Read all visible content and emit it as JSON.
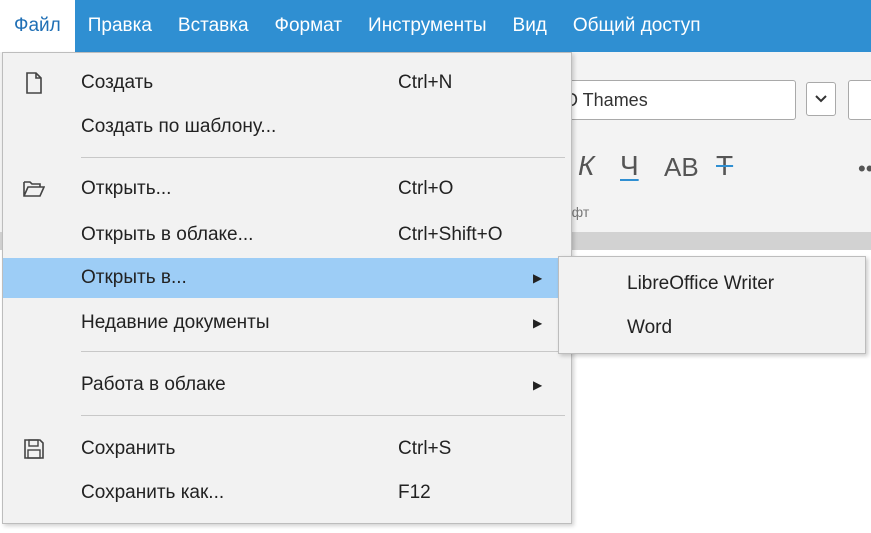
{
  "menubar": {
    "items": [
      {
        "label": "Файл"
      },
      {
        "label": "Правка"
      },
      {
        "label": "Вставка"
      },
      {
        "label": "Формат"
      },
      {
        "label": "Инструменты"
      },
      {
        "label": "Вид"
      },
      {
        "label": "Общий доступ"
      }
    ]
  },
  "toolbar": {
    "font_value": "D Thames",
    "italic_label": "К",
    "underline_label": "Ч",
    "caps_label": "АВ",
    "strike_label": "Т",
    "more_label": "••",
    "group_label": "рифт"
  },
  "file_menu": {
    "new": {
      "label": "Создать",
      "shortcut": "Ctrl+N",
      "icon": "new-document-icon"
    },
    "new_from_template": {
      "label": "Создать по шаблону..."
    },
    "open": {
      "label": "Открыть...",
      "shortcut": "Ctrl+O",
      "icon": "folder-open-icon"
    },
    "open_cloud": {
      "label": "Открыть в облаке...",
      "shortcut": "Ctrl+Shift+O"
    },
    "open_in": {
      "label": "Открыть в...",
      "has_submenu": true,
      "highlighted": true
    },
    "recent": {
      "label": "Недавние документы",
      "has_submenu": true
    },
    "cloud_work": {
      "label": "Работа в облаке",
      "has_submenu": true
    },
    "save": {
      "label": "Сохранить",
      "shortcut": "Ctrl+S",
      "icon": "save-icon"
    },
    "save_as": {
      "label": "Сохранить как...",
      "shortcut": "F12"
    }
  },
  "open_in_submenu": {
    "items": [
      {
        "label": "LibreOffice Writer"
      },
      {
        "label": "Word"
      }
    ]
  },
  "colors": {
    "menubar_bg": "#2f8fd2",
    "highlight": "#9dcdf6",
    "menu_bg": "#f2f2f2"
  }
}
